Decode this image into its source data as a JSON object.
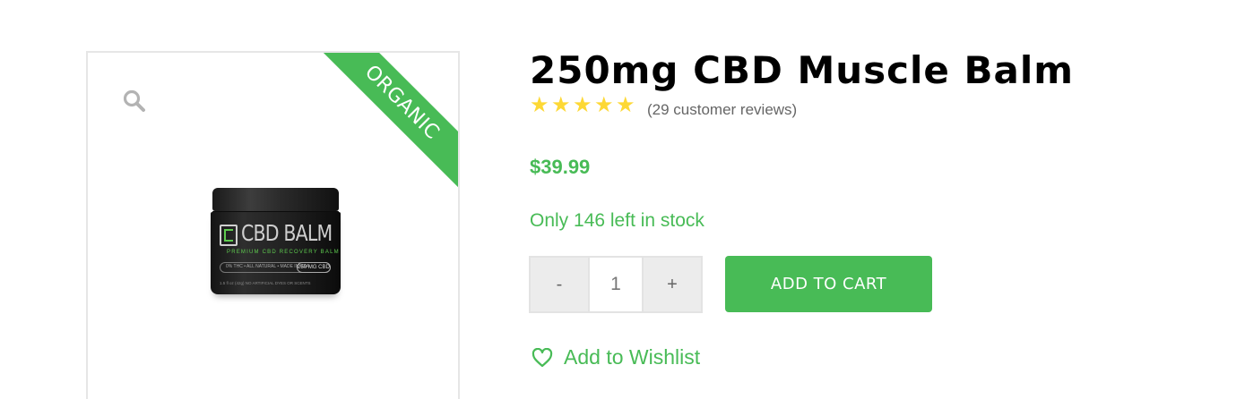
{
  "gallery": {
    "zoom_icon": "magnifier-icon",
    "ribbon_text": "ORGANIC",
    "jar": {
      "title": "CBD BALM",
      "subtitle": "PREMIUM CBD RECOVERY BALM",
      "badges": "0% THC • ALL NATURAL • MADE IN USA",
      "strength": "250 MG CBD",
      "footer": "1.5 fl oz (42g)        NO ARTIFICIAL DYES OR SCENTS"
    }
  },
  "product": {
    "title": "250mg CBD Muscle Balm",
    "rating": {
      "stars": 5,
      "max": 5,
      "reviews_text": "(29 customer reviews)"
    },
    "price": "$39.99",
    "stock": "Only 146 left in stock",
    "quantity": {
      "minus_label": "-",
      "value": "1",
      "plus_label": "+"
    },
    "add_to_cart_label": "ADD TO CART",
    "wishlist_label": "Add to Wishlist",
    "wishlist_icon": "heart-icon"
  },
  "colors": {
    "accent": "#48bb56",
    "star": "#fdd835",
    "title": "#000000",
    "muted": "#666666"
  }
}
